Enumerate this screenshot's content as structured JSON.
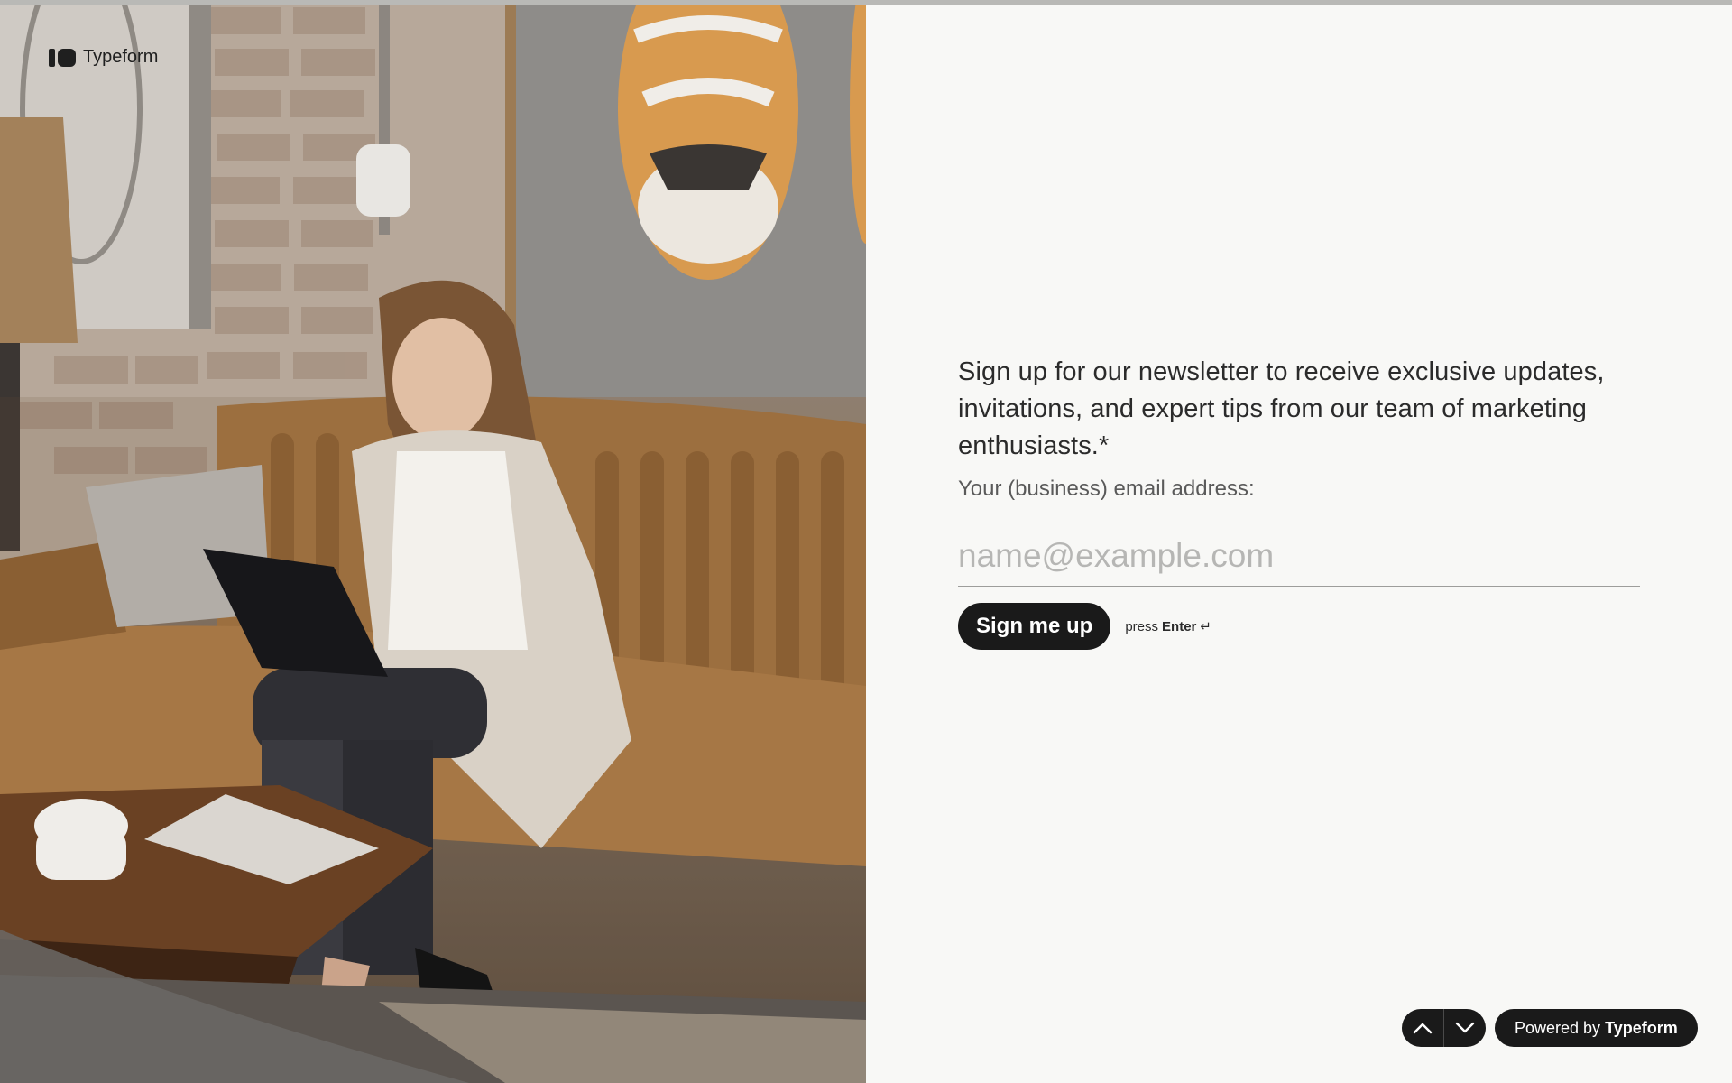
{
  "progress": {
    "percent": 100
  },
  "brand": {
    "name": "Typeform",
    "icon": "typeform-logo-icon"
  },
  "photo": {
    "alt_subject": "woman-using-laptop-on-sofa"
  },
  "form": {
    "question": "Sign up for our newsletter to receive exclusive updates, invitations, and expert tips from our team of marketing enthusiasts.*",
    "description": "Your (business) email address:",
    "email": {
      "placeholder": "name@example.com",
      "value": ""
    },
    "submit_label": "Sign me up",
    "hint": {
      "prefix": "press",
      "key": "Enter",
      "icon": "enter-return-icon"
    }
  },
  "navigation": {
    "up_icon": "chevron-up-icon",
    "down_icon": "chevron-down-icon"
  },
  "footer": {
    "powered_prefix": "Powered by",
    "powered_brand": "Typeform"
  },
  "colors": {
    "page_background": "#f8f8f6",
    "text": "#2b2b2b",
    "button_background": "#1a1a1a",
    "button_text": "#ffffff",
    "placeholder": "#b6b6b4"
  }
}
